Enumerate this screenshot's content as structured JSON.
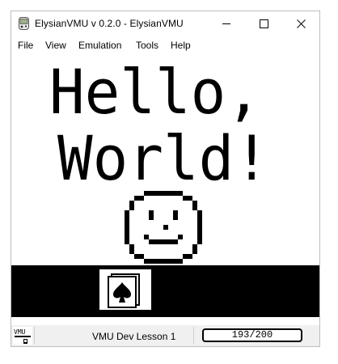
{
  "window": {
    "title": "ElysianVMU v 0.2.0 - ElysianVMU",
    "controls": {
      "minimize": "minimize-icon",
      "maximize": "maximize-icon",
      "close": "close-icon"
    }
  },
  "menubar": {
    "items": [
      {
        "label": "File"
      },
      {
        "label": "View"
      },
      {
        "label": "Emulation"
      },
      {
        "label": "Tools"
      },
      {
        "label": "Help"
      }
    ]
  },
  "screen": {
    "line1": "Hello,",
    "line2": "World!",
    "graphic": "smiley-face-icon",
    "pixel_color": "#000000",
    "background_color": "#ffffff"
  },
  "icon_strip": {
    "icon": "file-spade-icon",
    "strip_color": "#000000"
  },
  "statusbar": {
    "lesson": "VMU Dev Lesson 1",
    "counter": "193/200"
  }
}
